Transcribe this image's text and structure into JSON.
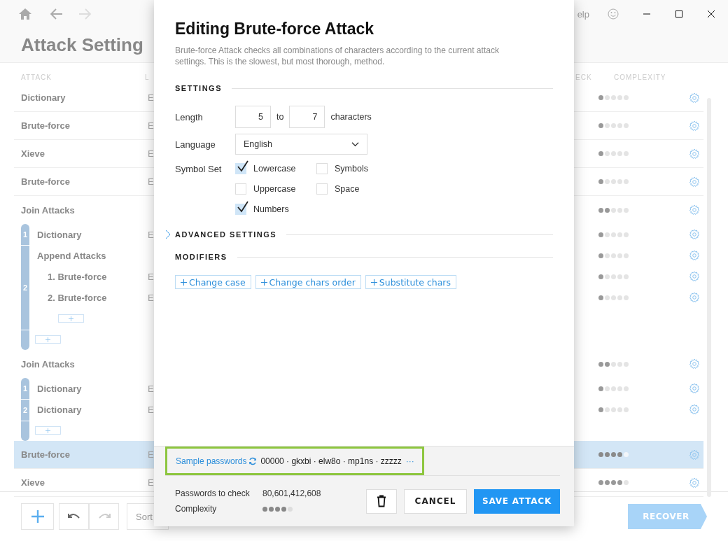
{
  "window": {
    "help": "elp"
  },
  "page_title": "Attack Setting",
  "columns": {
    "attack": "ATTACK",
    "column_2": "L",
    "column_3": "ECK",
    "complexity": "COMPLEXITY"
  },
  "rows": [
    {
      "name": "Dictionary",
      "lang": "E",
      "stars": 1,
      "selected": false
    },
    {
      "name": "Brute-force",
      "lang": "E",
      "stars": 1,
      "selected": false
    },
    {
      "name": "Xieve",
      "lang": "E",
      "stars": 1,
      "selected": false
    },
    {
      "name": "Brute-force",
      "lang": "E",
      "stars": 1,
      "selected": false
    },
    {
      "name": "Join Attacks",
      "stars": 2,
      "selected": false,
      "children": [
        {
          "index": "1",
          "name": "Dictionary",
          "lang": "E",
          "stars": 1,
          "selected": false
        },
        {
          "index": "2",
          "name": "Append Attacks",
          "stars": 1,
          "selected": false,
          "children": [
            {
              "name": "1. Brute-force",
              "lang": "E",
              "stars": 1,
              "selected": false
            },
            {
              "name": "2. Brute-force",
              "lang": "E",
              "stars": 1,
              "selected": false
            }
          ]
        }
      ]
    },
    {
      "name": "Join Attacks",
      "stars": 2,
      "selected": false,
      "children": [
        {
          "index": "1",
          "name": "Dictionary",
          "lang": "E",
          "stars": 1,
          "selected": false
        },
        {
          "index": "2",
          "name": "Dictionary",
          "lang": "E",
          "stars": 1,
          "selected": false
        }
      ]
    },
    {
      "name": "Brute-force",
      "lang": "E",
      "stars": 4,
      "selected": true
    },
    {
      "name": "Xieve",
      "lang": "E",
      "stars": 4,
      "selected": false
    }
  ],
  "toolbar": {
    "sort": "Sort",
    "recover": {
      "label": "RECOVER",
      "disabled": true
    }
  },
  "dialog": {
    "title": "Editing Brute-force Attack",
    "description": "Brute-force Attack checks all combinations of characters according to the current attack settings. This is the slowest, but most thorough, method.",
    "settings_label": "SETTINGS",
    "length": {
      "label": "Length",
      "from": "5",
      "to_label": "to",
      "to": "7",
      "unit": "characters"
    },
    "language": {
      "label": "Language",
      "value": "English"
    },
    "symbol_set": {
      "label": "Symbol Set",
      "options": [
        {
          "label": "Lowercase",
          "checked": true
        },
        {
          "label": "Symbols",
          "checked": false
        },
        {
          "label": "Uppercase",
          "checked": false
        },
        {
          "label": "Space",
          "checked": false
        },
        {
          "label": "Numbers",
          "checked": true
        }
      ]
    },
    "advanced": {
      "label": "ADVANCED SETTINGS",
      "expanded": false
    },
    "modifiers_label": "MODIFIERS",
    "modifiers": [
      "Change case",
      "Change chars order",
      "Substitute chars"
    ],
    "sample": {
      "label": "Sample passwords",
      "values": "00000 · gkxbi · elw8o · mp1ns · zzzzz",
      "more": "···",
      "highlighted": true
    },
    "passwords_label": "Passwords to check",
    "passwords_value": "80,601,412,608",
    "complexity": {
      "label": "Complexity",
      "stars": 4
    },
    "buttons": {
      "cancel": "CANCEL",
      "save": "SAVE ATTACK"
    }
  }
}
